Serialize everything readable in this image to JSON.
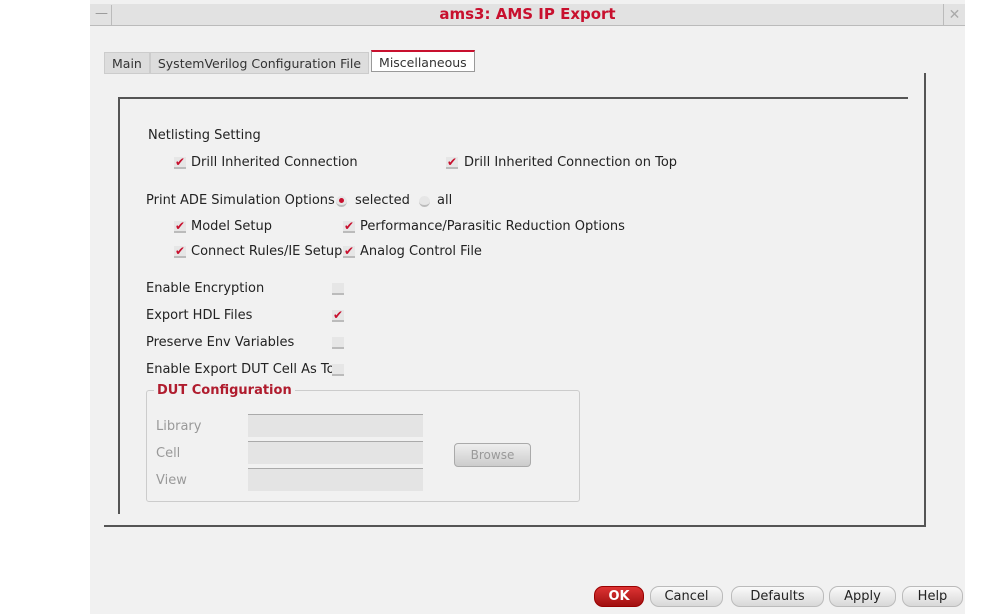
{
  "window": {
    "title": "ams3: AMS IP Export"
  },
  "tabs": [
    {
      "label": "Main"
    },
    {
      "label": "SystemVerilog Configuration File"
    },
    {
      "label": "Miscellaneous",
      "active": true
    }
  ],
  "netlisting": {
    "heading": "Netlisting Setting",
    "drill_inherited": {
      "label": "Drill Inherited Connection",
      "checked": true
    },
    "drill_inherited_top": {
      "label": "Drill Inherited Connection on Top",
      "checked": true
    }
  },
  "ade": {
    "label": "Print ADE Simulation Options",
    "radio_selected": "selected",
    "radio_all": "all",
    "value": "selected",
    "model_setup": {
      "label": "Model Setup",
      "checked": true
    },
    "performance": {
      "label": "Performance/Parasitic Reduction Options",
      "checked": true
    },
    "connect_rules": {
      "label": "Connect Rules/IE Setup",
      "checked": true
    },
    "analog_control": {
      "label": "Analog Control File",
      "checked": true
    }
  },
  "options": {
    "encryption": {
      "label": "Enable Encryption",
      "checked": false
    },
    "export_hdl": {
      "label": "Export HDL Files",
      "checked": true
    },
    "preserve_env": {
      "label": "Preserve Env Variables",
      "checked": false
    },
    "export_dut": {
      "label": "Enable Export DUT Cell As Top",
      "checked": false
    }
  },
  "dut": {
    "title": "DUT Configuration",
    "library_label": "Library",
    "cell_label": "Cell",
    "view_label": "View",
    "library": "",
    "cell": "",
    "view": "",
    "browse": "Browse"
  },
  "buttons": {
    "ok": "OK",
    "cancel": "Cancel",
    "defaults": "Defaults",
    "apply": "Apply",
    "help": "Help"
  },
  "icons": {
    "check": "✔",
    "close": "✕",
    "minimize": "—"
  }
}
